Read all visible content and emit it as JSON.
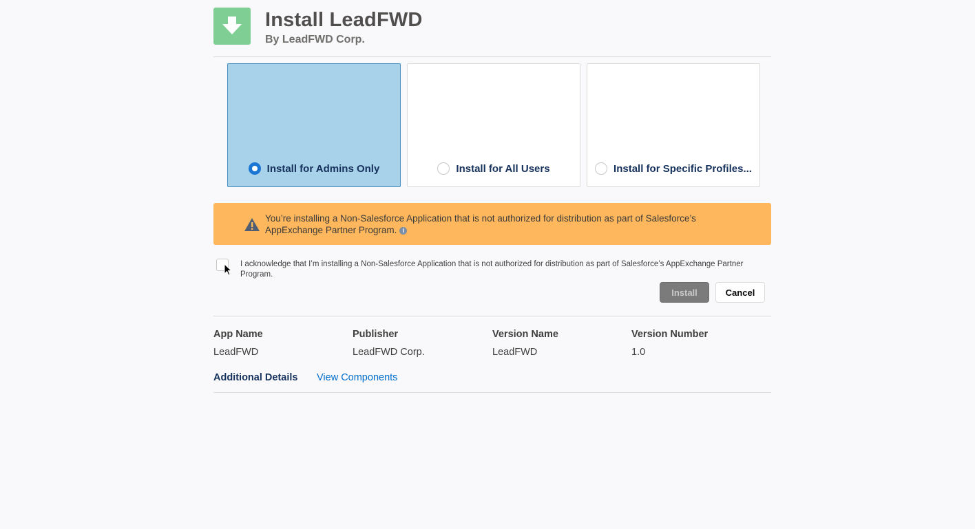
{
  "header": {
    "title": "Install LeadFWD",
    "subtitle": "By LeadFWD Corp.",
    "icon": "download-arrow-icon",
    "icon_color": "#7fcf95"
  },
  "install_options": [
    {
      "label": "Install for Admins Only",
      "selected": true
    },
    {
      "label": "Install for All Users",
      "selected": false
    },
    {
      "label": "Install for Specific Profiles...",
      "selected": false
    }
  ],
  "warning": {
    "text": "You’re installing a Non-Salesforce Application that is not authorized for distribution as part of Salesforce’s AppExchange Partner Program.",
    "info": "i",
    "color": "#ffb75d"
  },
  "acknowledge": {
    "checked": false,
    "text": "I acknowledge that I’m installing a Non-Salesforce Application that is not authorized for distribution as part of Salesforce’s AppExchange Partner Program."
  },
  "buttons": {
    "install": "Install",
    "cancel": "Cancel"
  },
  "details": {
    "app_name_label": "App Name",
    "app_name": "LeadFWD",
    "publisher_label": "Publisher",
    "publisher": "LeadFWD Corp.",
    "version_name_label": "Version Name",
    "version_name": "LeadFWD",
    "version_number_label": "Version Number",
    "version_number": "1.0"
  },
  "additional": {
    "label": "Additional Details",
    "link": "View Components"
  }
}
